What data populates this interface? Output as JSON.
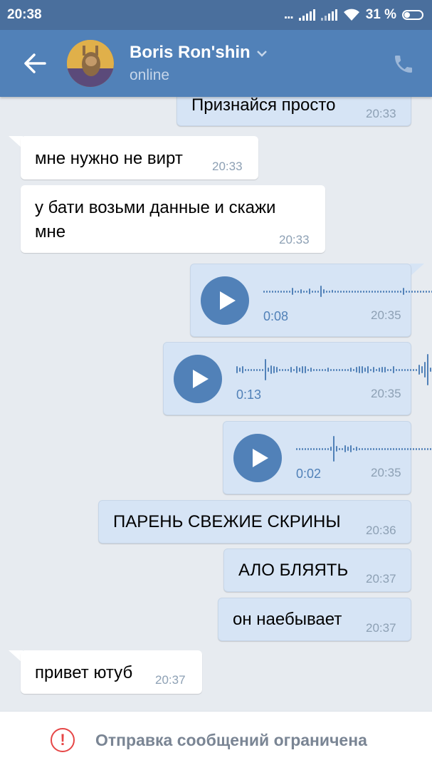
{
  "status_bar": {
    "time": "20:38",
    "dots": "...",
    "battery": "31 %"
  },
  "header": {
    "name": "Boris Ron'shin",
    "status": "online"
  },
  "messages": [
    {
      "dir": "out",
      "text": "Признайся просто",
      "time": "20:33"
    },
    {
      "dir": "in",
      "text": "мне нужно не вирт",
      "time": "20:33"
    },
    {
      "dir": "in",
      "text_line1": "у бати возьми данные и скажи",
      "text_line2": "мне",
      "time": "20:33"
    },
    {
      "dir": "out",
      "type": "voice",
      "duration": "0:08",
      "time": "20:35"
    },
    {
      "dir": "out",
      "type": "voice",
      "duration": "0:13",
      "time": "20:35"
    },
    {
      "dir": "out",
      "type": "voice",
      "duration": "0:02",
      "time": "20:35"
    },
    {
      "dir": "out",
      "text": "ПАРЕНЬ СВЕЖИЕ СКРИНЫ",
      "time": "20:36"
    },
    {
      "dir": "out",
      "text": "АЛО БЛЯЯТЬ",
      "time": "20:37"
    },
    {
      "dir": "out",
      "text": "он наебывает",
      "time": "20:37"
    },
    {
      "dir": "in",
      "text": "привет ютуб",
      "time": "20:37"
    }
  ],
  "footer": {
    "icon": "alert-circle-icon",
    "text": "Отправка сообщений ограничена"
  },
  "colors": {
    "header": "#5181b8",
    "statusbar": "#4a6f9d",
    "out_bubble": "#d6e4f5",
    "accent": "#5181b8",
    "warning": "#e64646"
  }
}
